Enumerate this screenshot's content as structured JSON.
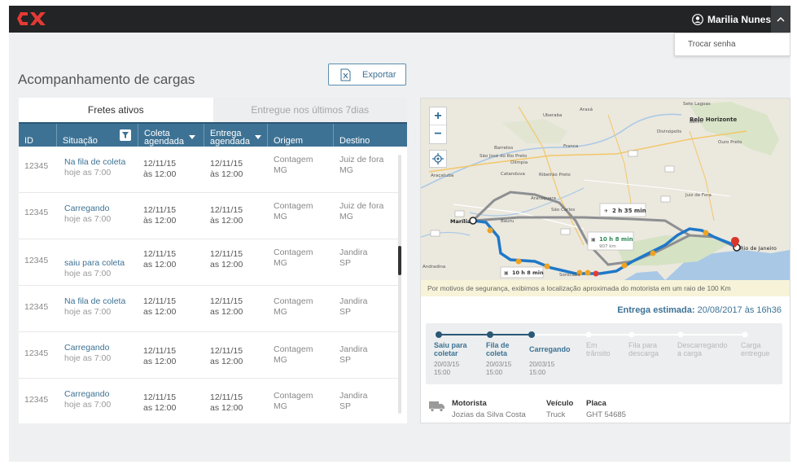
{
  "app": {
    "logo": "CX",
    "user_name": "Marilia Nunes",
    "dropdown_item": "Trocar senha",
    "brand_color": "#e53935",
    "accent_color": "#3d7294"
  },
  "page": {
    "title": "Acompanhamento de cargas",
    "export_label": "Exportar"
  },
  "tabs": [
    {
      "label": "Fretes ativos",
      "active": true
    },
    {
      "label": "Entregue nos últimos 7dias",
      "active": false
    }
  ],
  "table": {
    "headers": {
      "id": "ID",
      "situacao": "Situação",
      "coleta_1": "Coleta",
      "coleta_2": "agendada",
      "entrega_1": "Entrega",
      "entrega_2": "agendada",
      "origem": "Origem",
      "destino": "Destino"
    },
    "rows": [
      {
        "id": "12345",
        "status": "Na fila de coleta",
        "status_time": "hoje as 7:00",
        "coleta_date": "12/11/15",
        "coleta_time": "às 12:00",
        "entrega_date": "12/11/15",
        "entrega_time": "às 12:00",
        "origem_city": "Contagem",
        "origem_state": "MG",
        "destino_city": "Juiz de fora",
        "destino_state": "MG"
      },
      {
        "id": "12345",
        "status": "Carregando",
        "status_time": "hoje as 7:00",
        "coleta_date": "12/11/15",
        "coleta_time": "às 12:00",
        "entrega_date": "12/11/15",
        "entrega_time": "às 12:00",
        "origem_city": "Contagem",
        "origem_state": "MG",
        "destino_city": "Juiz de fora",
        "destino_state": "MG"
      },
      {
        "id": "12345",
        "status": "saiu para coleta",
        "status_time": "hoje as 7:00",
        "coleta_date": "12/11/15",
        "coleta_time": "as 12:00",
        "entrega_date": "12/11/15",
        "entrega_time": "as 12:00",
        "origem_city": "Contagem",
        "origem_state": "MG",
        "destino_city": "Jandira",
        "destino_state": "SP"
      },
      {
        "id": "12345",
        "status": "Na fila de coleta",
        "status_time": "hoje as 7:00",
        "coleta_date": "12/11/15",
        "coleta_time": "as 12:00",
        "entrega_date": "12/11/15",
        "entrega_time": "as 12:00",
        "origem_city": "Contagem",
        "origem_state": "MG",
        "destino_city": "Jandira",
        "destino_state": "SP"
      },
      {
        "id": "12345",
        "status": "Carregando",
        "status_time": "hoje as 7:00",
        "coleta_date": "12/11/15",
        "coleta_time": "as 12:00",
        "entrega_date": "12/11/15",
        "entrega_time": "as 12:00",
        "origem_city": "Contagem",
        "origem_state": "MG",
        "destino_city": "Jandira",
        "destino_state": "SP"
      },
      {
        "id": "12345",
        "status": "Carregando",
        "status_time": "hoje as 7:00",
        "coleta_date": "12/11/15",
        "coleta_time": "as 12:00",
        "entrega_date": "12/11/15",
        "entrega_time": "as 12:00",
        "origem_city": "Contagem",
        "origem_state": "MG",
        "destino_city": "Jandira",
        "destino_state": "SP"
      }
    ]
  },
  "map": {
    "origin_label": "Marília",
    "destination_label": "Rio de Janeiro",
    "route_times": [
      "2 h 35 min",
      "10 h 8 min",
      "10 h 8 min"
    ],
    "route_distance": "907 km",
    "cities": [
      "Uberaba",
      "Araxá",
      "Sete Lagoas",
      "Belo Horizonte",
      "Divinópolis",
      "Ouro Preto",
      "Franca",
      "Barretos",
      "São José do Rio Preto",
      "Araçatuba",
      "Catanduva",
      "Ribeirão Preto",
      "Araraquara",
      "São Carlos",
      "Bauru",
      "Sorocaba",
      "Juiz de Fora",
      "Olímpia",
      "Betim",
      "Andradina"
    ],
    "zoom_in": "+",
    "zoom_out": "−"
  },
  "notice": "Por motivos de segurança,  exibimos a localização aproximada do motorista em um raio de 100 Km",
  "eta": {
    "label": "Entrega estimada:",
    "value": "20/08/2017 às 16h36"
  },
  "steps": [
    {
      "line1": "Saiu para",
      "line2": "coletar",
      "date": "20/03/15",
      "time": "15:00",
      "done": true
    },
    {
      "line1": "Fila de",
      "line2": "coleta",
      "date": "20/03/15",
      "time": "15:00",
      "done": true
    },
    {
      "line1": "Carregando",
      "line2": "",
      "date": "20/03/15",
      "time": "15:00",
      "done": true
    },
    {
      "line1": "Em",
      "line2": "trânsito",
      "date": "",
      "time": "",
      "done": false
    },
    {
      "line1": "Fila para",
      "line2": "descarga",
      "date": "",
      "time": "",
      "done": false
    },
    {
      "line1": "Descarregando",
      "line2": "a carga",
      "date": "",
      "time": "",
      "done": false
    },
    {
      "line1": "Carga",
      "line2": "entregue",
      "date": "",
      "time": "",
      "done": false
    }
  ],
  "driver": {
    "motorista_label": "Motorista",
    "motorista_value": "Jozias da Silva Costa",
    "veiculo_label": "Veículo",
    "veiculo_value": "Truck",
    "placa_label": "Placa",
    "placa_value": "GHT 54685"
  }
}
